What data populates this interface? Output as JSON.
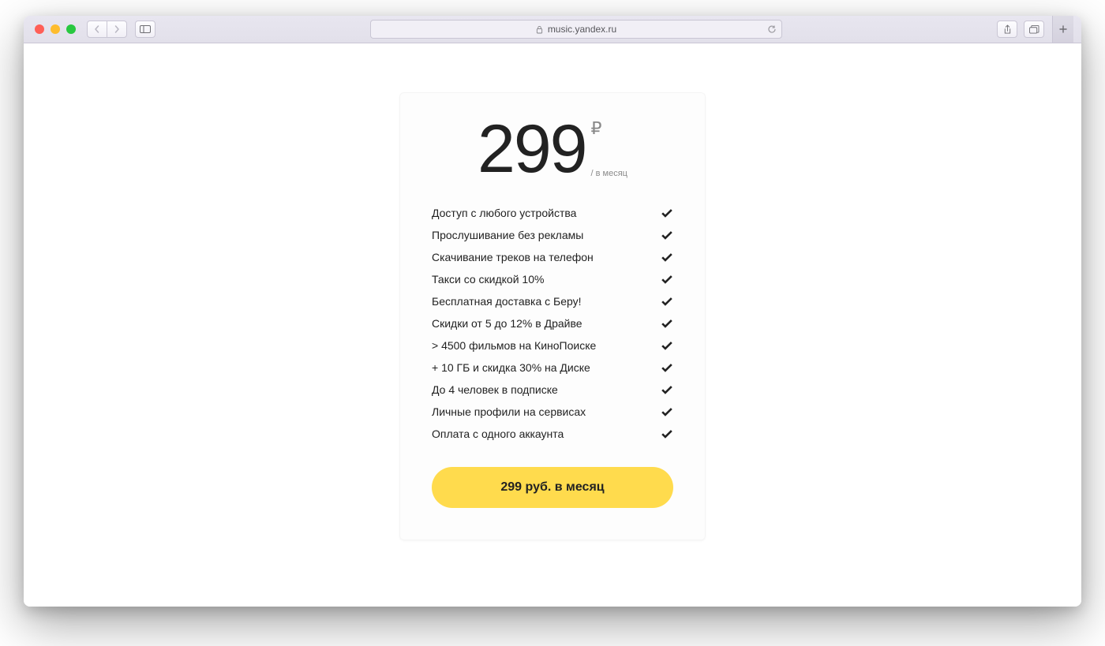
{
  "browser": {
    "url_display": "music.yandex.ru"
  },
  "plan": {
    "price_value": "299",
    "currency_symbol": "₽",
    "period_label": "/ в месяц",
    "cta_label": "299 руб. в месяц",
    "features": [
      "Доступ с любого устройства",
      "Прослушивание без рекламы",
      "Скачивание треков на телефон",
      "Такси со скидкой 10%",
      "Бесплатная доставка с Беру!",
      "Скидки от 5 до 12% в Драйве",
      "> 4500 фильмов на КиноПоиске",
      "+ 10 ГБ и скидка 30% на Диске",
      "До 4 человек в подписке",
      "Личные профили на сервисах",
      "Оплата с одного аккаунта"
    ]
  }
}
